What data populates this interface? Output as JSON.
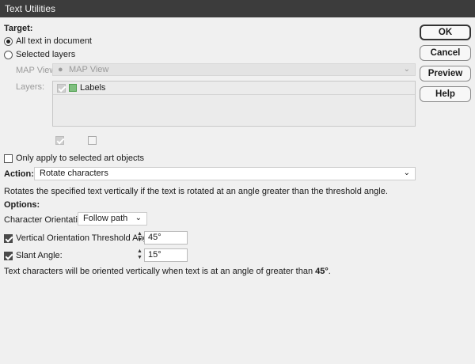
{
  "window": {
    "title": "Text Utilities"
  },
  "target": {
    "heading": "Target:",
    "option_all": "All text in document",
    "option_selected": "Selected layers",
    "map_view_label": "MAP View:",
    "map_view_value": "MAP View",
    "layers_label": "Layers:",
    "layer_items": [
      {
        "name": "Labels"
      }
    ]
  },
  "only_selected_label": "Only apply to selected art objects",
  "action": {
    "label": "Action:",
    "value": "Rotate characters",
    "description": "Rotates the specified text vertically if the text is rotated at an angle greater than the threshold angle."
  },
  "options": {
    "heading": "Options:",
    "orientation_label": "Character Orientation:",
    "orientation_value": "Follow path",
    "threshold_label": "Vertical Orientation Threshold Angle:",
    "threshold_value": "45°",
    "slant_label": "Slant Angle:",
    "slant_value": "15°"
  },
  "footer": {
    "text_prefix": "Text characters will be oriented vertically when text is at an angle of greater than ",
    "angle": "45°",
    "text_suffix": "."
  },
  "buttons": {
    "ok": "OK",
    "cancel": "Cancel",
    "preview": "Preview",
    "help": "Help"
  },
  "colors": {
    "titlebar": "#3c3c3c",
    "dialog_bg": "#f0f0f0"
  }
}
